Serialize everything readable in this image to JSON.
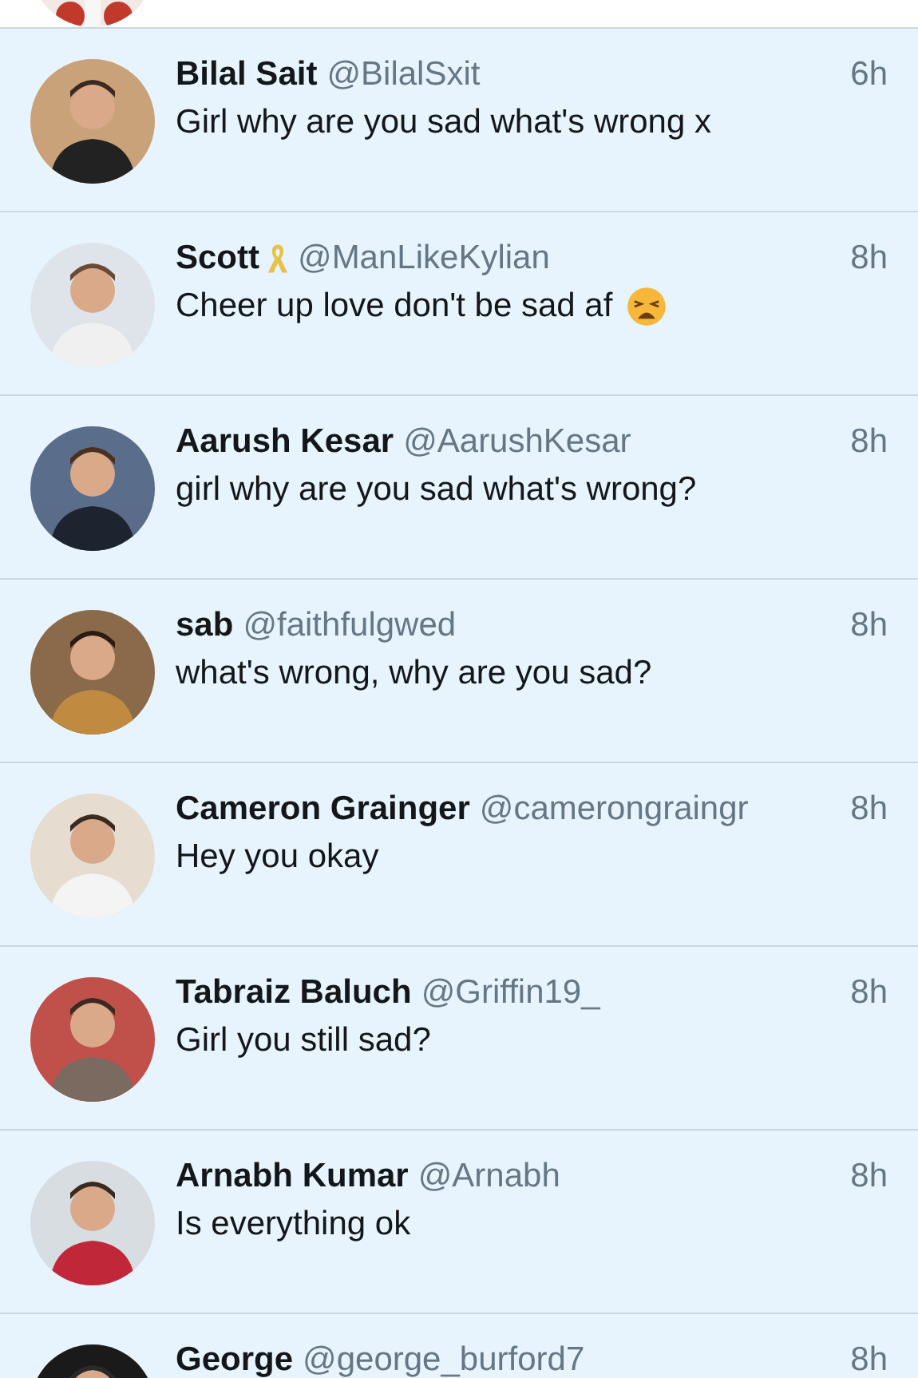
{
  "rows": [
    {
      "name": "Bilal Sait",
      "handle": "@BilalSxit",
      "time": "6h",
      "message": "Girl why are you sad what's wrong x",
      "ribbon": false,
      "emoji": false
    },
    {
      "name": "Scott",
      "handle": "@ManLikeKylian",
      "time": "8h",
      "message": "Cheer up love don't be sad af",
      "ribbon": true,
      "emoji": true
    },
    {
      "name": "Aarush Kesar",
      "handle": "@AarushKesar",
      "time": "8h",
      "message": "girl why are you sad what's wrong?",
      "ribbon": false,
      "emoji": false
    },
    {
      "name": "sab",
      "handle": "@faithfulgwed",
      "time": "8h",
      "message": "what's wrong, why are you sad?",
      "ribbon": false,
      "emoji": false
    },
    {
      "name": "Cameron Grainger",
      "handle": "@camerongraingr",
      "time": "8h",
      "message": "Hey you okay",
      "ribbon": false,
      "emoji": false
    },
    {
      "name": "Tabraiz Baluch",
      "handle": "@Griffin19_",
      "time": "8h",
      "message": "Girl you still sad?",
      "ribbon": false,
      "emoji": false
    },
    {
      "name": "Arnabh Kumar",
      "handle": "@Arnabh",
      "time": "8h",
      "message": "Is everything ok",
      "ribbon": false,
      "emoji": false
    },
    {
      "name": "George",
      "handle": "@george_burford7",
      "time": "8h"
    }
  ]
}
